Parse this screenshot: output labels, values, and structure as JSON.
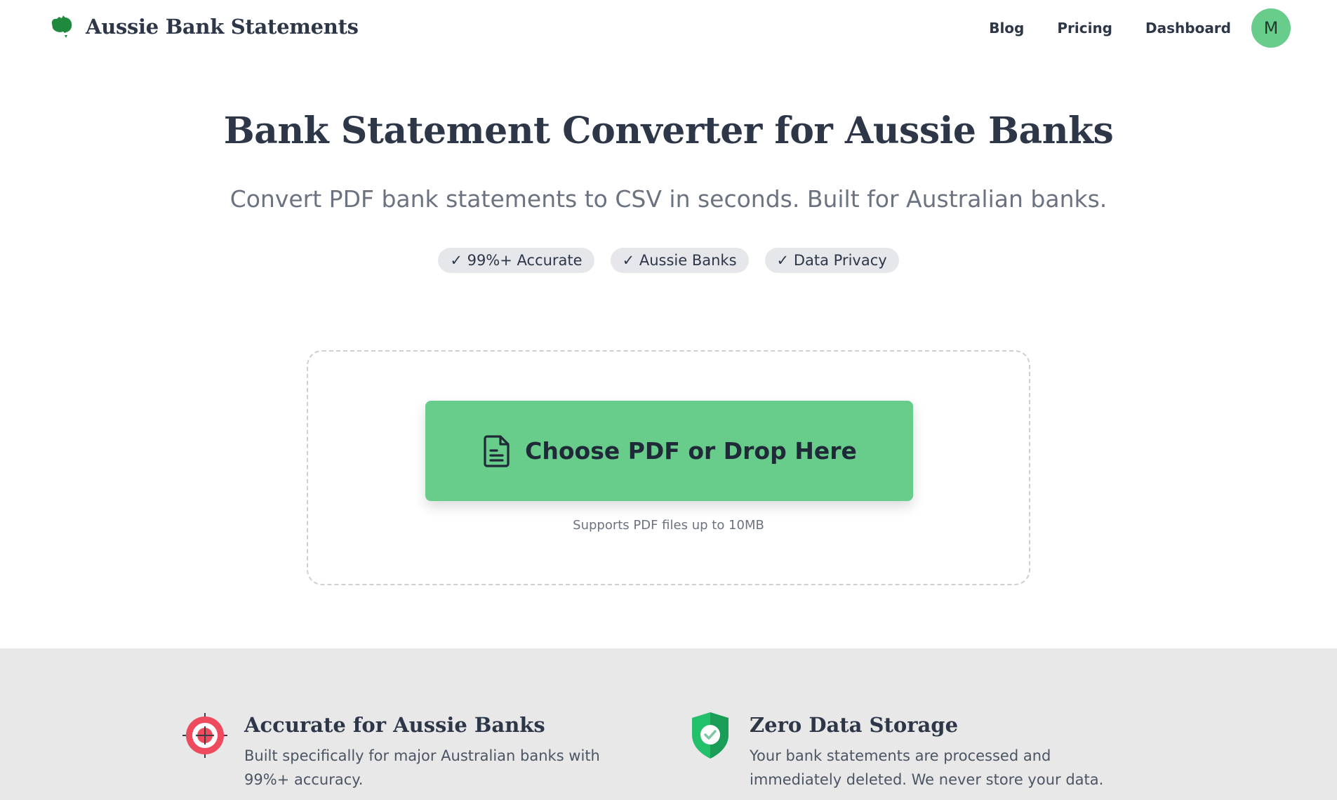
{
  "header": {
    "brand_name": "Aussie Bank Statements",
    "logo_icon": "australia-map-icon",
    "nav": {
      "blog": "Blog",
      "pricing": "Pricing",
      "dashboard": "Dashboard"
    },
    "avatar_initial": "M"
  },
  "hero": {
    "title": "Bank Statement Converter for Aussie Banks",
    "subtitle": "Convert PDF bank statements to CSV in seconds. Built for Australian banks.",
    "badges": [
      "✓ 99%+ Accurate",
      "✓ Aussie Banks",
      "✓ Data Privacy"
    ]
  },
  "upload": {
    "button_label": "Choose PDF or Drop Here",
    "button_icon": "document-icon",
    "hint": "Supports PDF files up to 10MB"
  },
  "features": [
    {
      "icon": "target-icon",
      "title": "Accurate for Aussie Banks",
      "description": "Built specifically for major Australian banks with 99%+ accuracy."
    },
    {
      "icon": "shield-check-icon",
      "title": "Zero Data Storage",
      "description": "Your bank statements are processed and immediately deleted. We never store your data."
    }
  ],
  "colors": {
    "accent_green": "#68cc8b",
    "text_dark": "#2d3748",
    "text_muted": "#6b7280",
    "features_bg": "#e8e8e9",
    "target_red": "#ef4b5f",
    "shield_green": "#22c06b"
  }
}
